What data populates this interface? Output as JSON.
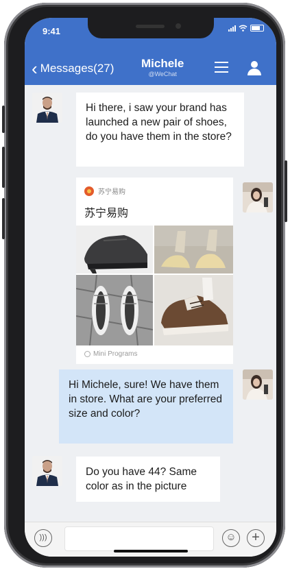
{
  "status_bar": {
    "time": "9:41"
  },
  "header": {
    "back_label": "Messages(27)",
    "contact_name": "Michele",
    "contact_subtitle": "@WeChat",
    "accent_color": "#3f71c9"
  },
  "messages": [
    {
      "sender": "customer",
      "type": "text",
      "text": "Hi there, i saw your brand has launched a new pair of shoes, do you have them in the store?"
    },
    {
      "sender": "michele",
      "type": "mini_program_card",
      "brand": "苏宁易购",
      "title": "苏宁易购",
      "footer": "Mini Programs"
    },
    {
      "sender": "michele",
      "type": "text",
      "text": "Hi Michele, sure! We have them in store. What are your preferred size and color?"
    },
    {
      "sender": "customer",
      "type": "text",
      "text": "Do you have 44? Same color as in the picture"
    }
  ],
  "input_bar": {
    "value": ""
  }
}
